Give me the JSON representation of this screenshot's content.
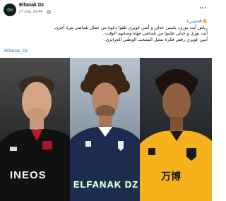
{
  "post": {
    "page_name": "Elfanak Dz",
    "avatar_text": "Dz",
    "timestamp": "27 mai, 20:44",
    "privacy_sep": "·",
    "caption": {
      "line1": "🔥#حصريا",
      "line2": "رياض أيت نوري، ياسين عدلي و أمين غويري تلقوا دعوة من جمال بلماضي مرة أخرى،",
      "line3": "أيت نوري و عدلي طلبوا من بلماضي مهلة ومنحهم الوقت..",
      "line4": "أمين غويري رفض فكرة تمثيل المنتخب الوطني الجزائري."
    },
    "hashtag": "#Elfanak_Dz"
  },
  "image": {
    "watermark": "ELFANAK DZ",
    "sponsor_left": "INEOS",
    "sponsor_right": "万博"
  },
  "colors": {
    "link": "#1b74e4",
    "watermark_glow": "#1a8a3b",
    "wolves_gold": "#f5b21c",
    "bordeaux_navy": "#1d2b4f"
  }
}
